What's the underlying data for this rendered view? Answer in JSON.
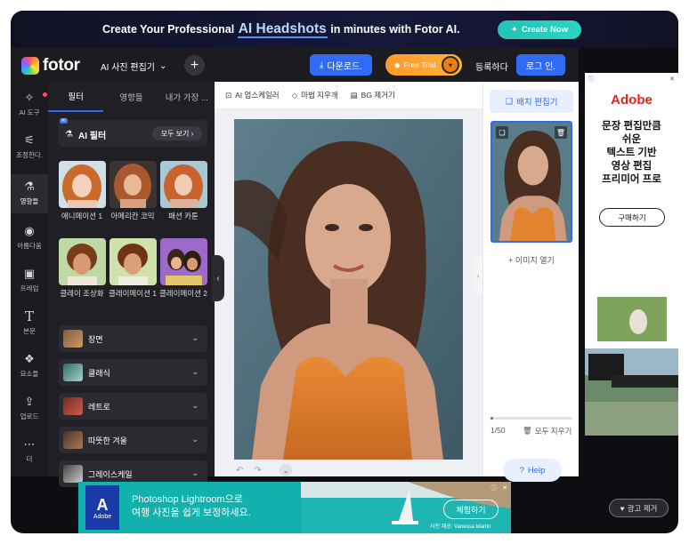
{
  "banner": {
    "text_before": "Create Your Professional",
    "highlight": "AI Headshots",
    "text_after": "in minutes with Fotor AI.",
    "cta": "Create Now"
  },
  "header": {
    "logo": "fotor",
    "menu": "AI 사진 편집기",
    "download": "다운로드.",
    "free_trial": "Free Trial",
    "signup": "등록하다",
    "login": "로그 인."
  },
  "rail": [
    {
      "label": "AI 도구",
      "icon": "sparkle-icon"
    },
    {
      "label": "조정한다.",
      "icon": "sliders-icon"
    },
    {
      "label": "영향들",
      "icon": "flask-icon"
    },
    {
      "label": "아름다움",
      "icon": "eye-icon"
    },
    {
      "label": "프레임",
      "icon": "frame-icon"
    },
    {
      "label": "본문",
      "icon": "text-icon"
    },
    {
      "label": "요소들",
      "icon": "elements-icon"
    },
    {
      "label": "업로드",
      "icon": "upload-icon"
    },
    {
      "label": "더",
      "icon": "more-icon"
    }
  ],
  "panel": {
    "tabs": [
      "필터",
      "영향들",
      "내가 가장 ..."
    ],
    "ai_badge": "AI",
    "ai_title": "AI 필터",
    "see_all": "모두 보기",
    "filters": [
      {
        "label": "애니메이션 1"
      },
      {
        "label": "아메리칸 코믹"
      },
      {
        "label": "패션 카툰"
      },
      {
        "label": "클레이 조상화"
      },
      {
        "label": "클레이메이션 1"
      },
      {
        "label": "클레이메이션 2"
      }
    ],
    "sections": [
      "장면",
      "클래식",
      "레트로",
      "따뜻한 겨울",
      "그레이스케일"
    ]
  },
  "toolbar": {
    "upscaler": "AI 업스케일러",
    "magic_erase": "마법 지우개",
    "bg_remove": "BG 제거기"
  },
  "right_panel": {
    "batch_edit": "배치 편집기",
    "open_image": "이미지 열기",
    "count": "1/50",
    "clear_all": "모두 지우기",
    "help": "Help",
    "progress": 0.03
  },
  "ad_right": {
    "brand": "Adobe",
    "copy": [
      "문장 편집만큼",
      "쉬운",
      "텍스트 기반",
      "영상 편집",
      "프리미어 프로"
    ],
    "buy": "구매하기"
  },
  "ad_bottom": {
    "logo": "Adobe",
    "line1": "Photoshop Lightroom으로",
    "line2": "여행 사진을 쉽게 보정하세요.",
    "cta": "체험하기",
    "artist": "사진 제공: Vanessa Martin"
  },
  "remove_ad": "광고 제거"
}
